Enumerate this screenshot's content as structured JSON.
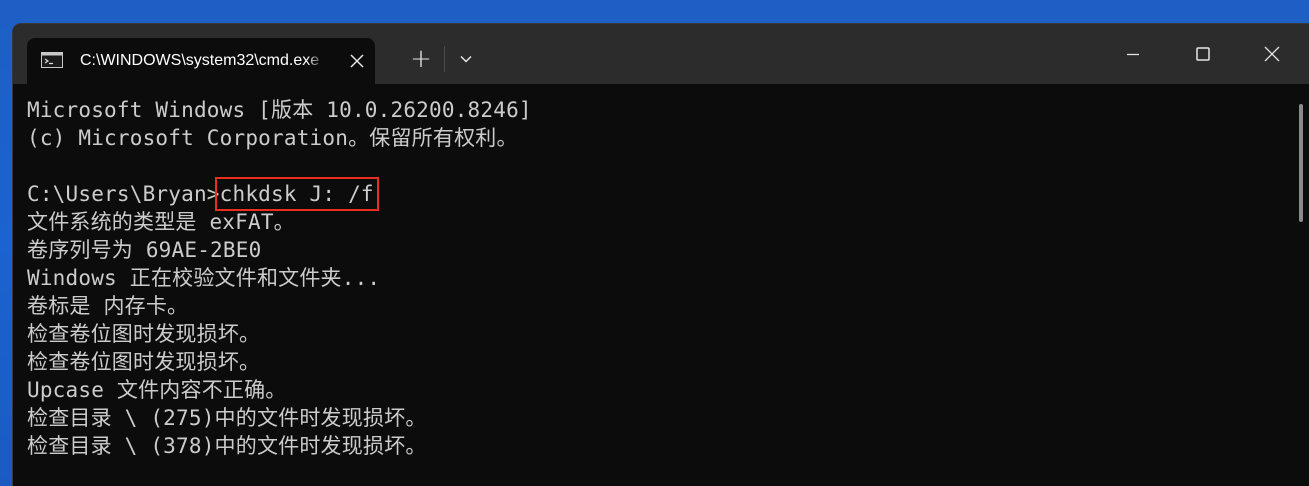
{
  "window": {
    "tab_title": "C:\\WINDOWS\\system32\\cmd.exe",
    "new_tab_glyph": "+",
    "icons": {
      "tab_icon": "terminal-icon",
      "tab_close": "close-icon",
      "new_tab": "plus-icon",
      "dropdown": "chevron-down-icon",
      "minimize": "minimize-icon",
      "maximize": "maximize-icon",
      "close": "close-icon"
    }
  },
  "console": {
    "lines": [
      "Microsoft Windows [版本 10.0.26200.8246]",
      "(c) Microsoft Corporation。保留所有权利。",
      "",
      "",
      "文件系统的类型是 exFAT。",
      "卷序列号为 69AE-2BE0",
      "Windows 正在校验文件和文件夹...",
      "卷标是 内存卡。",
      "检查卷位图时发现损坏。",
      "检查卷位图时发现损坏。",
      "Upcase 文件内容不正确。",
      "检查目录 \\ (275)中的文件时发现损坏。",
      "检查目录 \\ (378)中的文件时发现损坏。"
    ],
    "prompt": "C:\\Users\\Bryan>",
    "command": "chkdsk J: /f"
  },
  "colors": {
    "highlight_box": "#e8301d",
    "console_text": "#cccccc",
    "console_bg": "#0c0c0c",
    "titlebar_bg": "#2c2c2c"
  }
}
